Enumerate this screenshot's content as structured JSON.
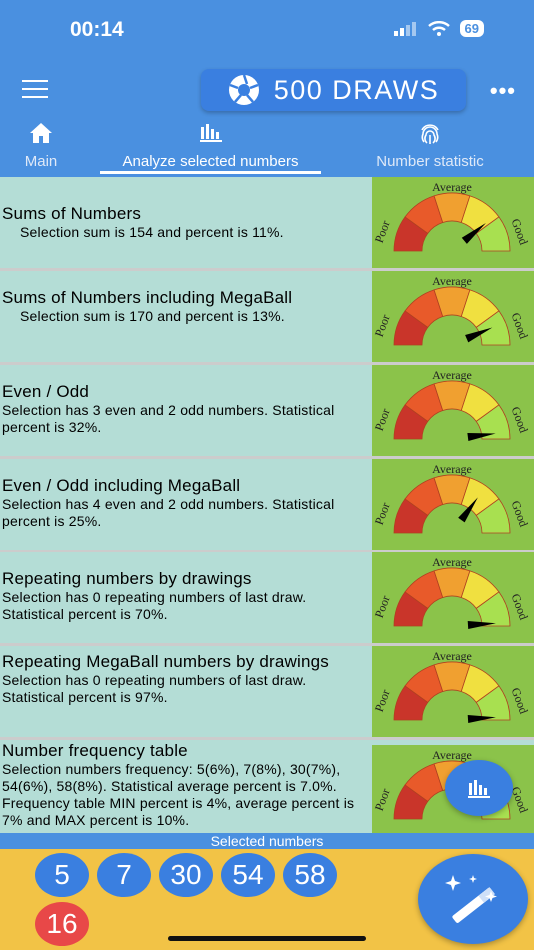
{
  "status_bar": {
    "time": "00:14",
    "battery": "69"
  },
  "app_bar": {
    "title": "500 DRAWS",
    "more": "•••"
  },
  "tabs": [
    {
      "label": "Main",
      "icon": "home-icon"
    },
    {
      "label": "Analyze selected numbers",
      "icon": "bar-chart-icon",
      "active": true
    },
    {
      "label": "Number statistic",
      "icon": "fingerprint-icon"
    }
  ],
  "gauge": {
    "average": "Average",
    "poor": "Poor",
    "good": "Good"
  },
  "cards": [
    {
      "title": "Sums of Numbers",
      "desc": "Selection sum is 154 and percent is 11%.",
      "needle_level": 0.78
    },
    {
      "title": "Sums of Numbers including MegaBall",
      "desc": "Selection sum is 170 and percent is 13%.",
      "needle_level": 0.87
    },
    {
      "title": "Even / Odd",
      "desc": "Selection has 3 even and 2 odd numbers. Statistical percent is 32%.",
      "needle_level": 0.96
    },
    {
      "title": "Even / Odd including MegaBall",
      "desc": "Selection has 4 even and 2 odd numbers. Statistical percent is 25%.",
      "needle_level": 0.7
    },
    {
      "title": "Repeating numbers by drawings",
      "desc": "Selection has 0 repeating numbers of last draw. Statistical percent is 70%.",
      "needle_level": 0.98
    },
    {
      "title": "Repeating MegaBall numbers by drawings",
      "desc": "Selection has 0 repeating numbers of last draw. Statistical percent is 97%.",
      "needle_level": 0.98
    },
    {
      "title": "Number frequency table",
      "desc": "Selection numbers frequency: 5(6%), 7(8%),  30(7%),  54(6%),  58(8%). Statistical average percent is 7.0%. Frequency table MIN percent is 4%, average percent is 7% and MAX percent is 10%.",
      "needle_level": 0.8
    }
  ],
  "selected_label": "Selected numbers",
  "selected_numbers": [
    "5",
    "7",
    "30",
    "54",
    "58"
  ],
  "megaball": "16",
  "colors": {
    "header": "#4a90e0",
    "pill": "#3a7fe0",
    "card_bg": "#b4ddd6",
    "gauge_bg": "#8bc34a",
    "footer": "#f2c346",
    "megaball": "#e84848"
  }
}
